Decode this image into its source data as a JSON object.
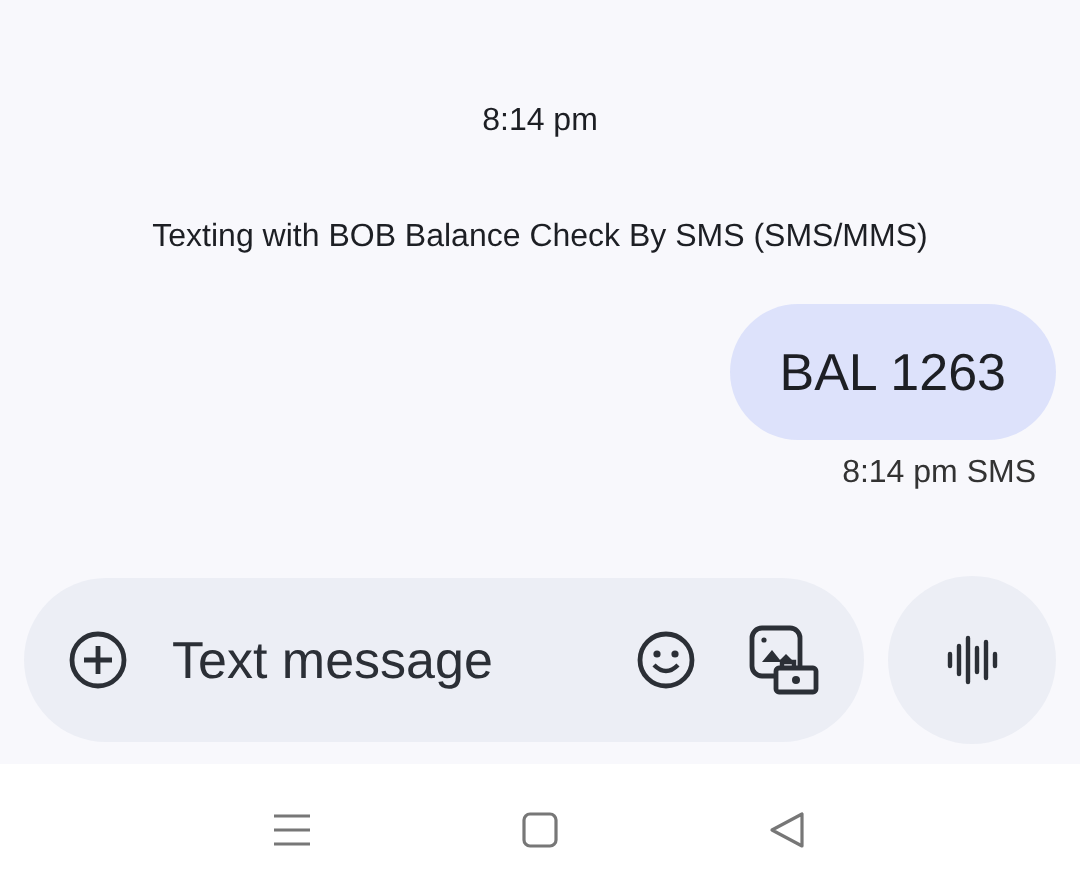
{
  "conversation": {
    "timestamp": "8:14 pm",
    "info": "Texting with BOB Balance Check By SMS (SMS/MMS)"
  },
  "messages": [
    {
      "text": "BAL 1263",
      "outgoing": true,
      "meta": "8:14 pm SMS"
    }
  ],
  "compose": {
    "placeholder": "Text message"
  }
}
